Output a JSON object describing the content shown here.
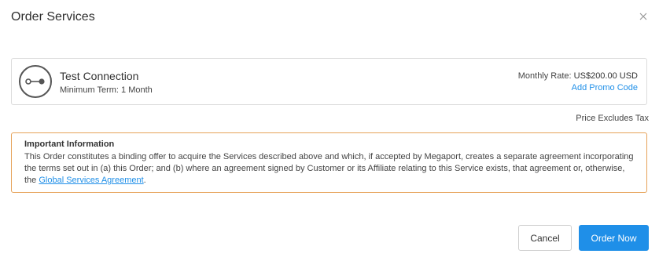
{
  "modal": {
    "title": "Order Services"
  },
  "service": {
    "name": "Test Connection",
    "term": "Minimum Term: 1 Month",
    "icon": "connection-icon",
    "rate_label": "Monthly Rate:",
    "rate_value": "US$200.00 USD",
    "promo_link": "Add Promo Code"
  },
  "tax_note": "Price Excludes Tax",
  "info": {
    "heading": "Important Information",
    "body_before_link": "This Order constitutes a binding offer to acquire the Services described above and which, if accepted by Megaport, creates a separate agreement incorporating the terms set out in (a) this Order; and (b) where an agreement signed by Customer or its Affiliate relating to this Service exists, that agreement or, otherwise, the ",
    "link_text": "Global Services Agreement",
    "body_after_link": "."
  },
  "actions": {
    "cancel_label": "Cancel",
    "order_label": "Order Now"
  },
  "colors": {
    "accent": "#1f8fe8",
    "warning_border": "#e6a259"
  }
}
